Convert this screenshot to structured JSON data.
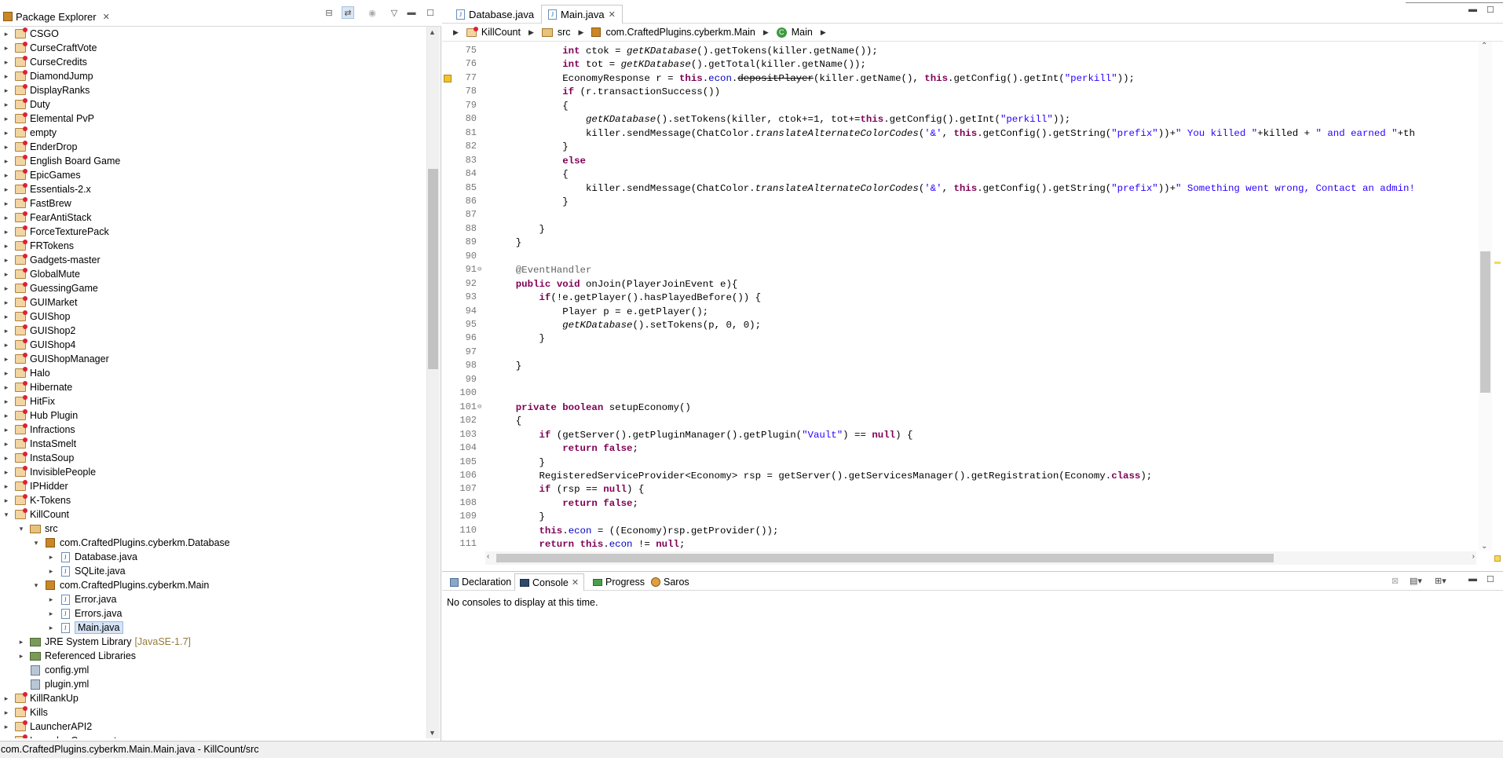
{
  "package_explorer": {
    "title": "Package Explorer",
    "items": [
      {
        "label": "CSGO",
        "type": "project",
        "depth": 0,
        "twisty": "▸"
      },
      {
        "label": "CurseCraftVote",
        "type": "project",
        "depth": 0,
        "twisty": "▸"
      },
      {
        "label": "CurseCredits",
        "type": "project",
        "depth": 0,
        "twisty": "▸"
      },
      {
        "label": "DiamondJump",
        "type": "project",
        "depth": 0,
        "twisty": "▸"
      },
      {
        "label": "DisplayRanks",
        "type": "project",
        "depth": 0,
        "twisty": "▸"
      },
      {
        "label": "Duty",
        "type": "project",
        "depth": 0,
        "twisty": "▸"
      },
      {
        "label": "Elemental PvP",
        "type": "project",
        "depth": 0,
        "twisty": "▸"
      },
      {
        "label": "empty",
        "type": "project",
        "depth": 0,
        "twisty": "▸"
      },
      {
        "label": "EnderDrop",
        "type": "project",
        "depth": 0,
        "twisty": "▸"
      },
      {
        "label": "English Board Game",
        "type": "project",
        "depth": 0,
        "twisty": "▸"
      },
      {
        "label": "EpicGames",
        "type": "project",
        "depth": 0,
        "twisty": "▸"
      },
      {
        "label": "Essentials-2.x",
        "type": "project",
        "depth": 0,
        "twisty": "▸"
      },
      {
        "label": "FastBrew",
        "type": "project",
        "depth": 0,
        "twisty": "▸"
      },
      {
        "label": "FearAntiStack",
        "type": "project",
        "depth": 0,
        "twisty": "▸"
      },
      {
        "label": "ForceTexturePack",
        "type": "project",
        "depth": 0,
        "twisty": "▸"
      },
      {
        "label": "FRTokens",
        "type": "project",
        "depth": 0,
        "twisty": "▸"
      },
      {
        "label": "Gadgets-master",
        "type": "project",
        "depth": 0,
        "twisty": "▸"
      },
      {
        "label": "GlobalMute",
        "type": "project",
        "depth": 0,
        "twisty": "▸"
      },
      {
        "label": "GuessingGame",
        "type": "project",
        "depth": 0,
        "twisty": "▸"
      },
      {
        "label": "GUIMarket",
        "type": "project",
        "depth": 0,
        "twisty": "▸"
      },
      {
        "label": "GUIShop",
        "type": "project",
        "depth": 0,
        "twisty": "▸"
      },
      {
        "label": "GUIShop2",
        "type": "project",
        "depth": 0,
        "twisty": "▸"
      },
      {
        "label": "GUIShop4",
        "type": "project",
        "depth": 0,
        "twisty": "▸"
      },
      {
        "label": "GUIShopManager",
        "type": "project",
        "depth": 0,
        "twisty": "▸"
      },
      {
        "label": "Halo",
        "type": "project",
        "depth": 0,
        "twisty": "▸"
      },
      {
        "label": "Hibernate",
        "type": "project",
        "depth": 0,
        "twisty": "▸"
      },
      {
        "label": "HitFix",
        "type": "project",
        "depth": 0,
        "twisty": "▸"
      },
      {
        "label": "Hub Plugin",
        "type": "project",
        "depth": 0,
        "twisty": "▸"
      },
      {
        "label": "Infractions",
        "type": "project",
        "depth": 0,
        "twisty": "▸"
      },
      {
        "label": "InstaSmelt",
        "type": "project",
        "depth": 0,
        "twisty": "▸"
      },
      {
        "label": "InstaSoup",
        "type": "project",
        "depth": 0,
        "twisty": "▸"
      },
      {
        "label": "InvisiblePeople",
        "type": "project",
        "depth": 0,
        "twisty": "▸"
      },
      {
        "label": "IPHidder",
        "type": "project",
        "depth": 0,
        "twisty": "▸"
      },
      {
        "label": "K-Tokens",
        "type": "project",
        "depth": 0,
        "twisty": "▸"
      },
      {
        "label": "KillCount",
        "type": "project",
        "depth": 0,
        "twisty": "▾"
      },
      {
        "label": "src",
        "type": "src",
        "depth": 1,
        "twisty": "▾"
      },
      {
        "label": "com.CraftedPlugins.cyberkm.Database",
        "type": "pkg",
        "depth": 2,
        "twisty": "▾"
      },
      {
        "label": "Database.java",
        "type": "java",
        "depth": 3,
        "twisty": "▸"
      },
      {
        "label": "SQLite.java",
        "type": "java",
        "depth": 3,
        "twisty": "▸"
      },
      {
        "label": "com.CraftedPlugins.cyberkm.Main",
        "type": "pkg",
        "depth": 2,
        "twisty": "▾"
      },
      {
        "label": "Error.java",
        "type": "java",
        "depth": 3,
        "twisty": "▸"
      },
      {
        "label": "Errors.java",
        "type": "java",
        "depth": 3,
        "twisty": "▸"
      },
      {
        "label": "Main.java",
        "type": "java",
        "depth": 3,
        "twisty": "▸",
        "selected": true
      },
      {
        "label": "JRE System Library",
        "suffix": "[JavaSE-1.7]",
        "type": "lib",
        "depth": 1,
        "twisty": "▸"
      },
      {
        "label": "Referenced Libraries",
        "type": "lib",
        "depth": 1,
        "twisty": "▸"
      },
      {
        "label": "config.yml",
        "type": "yml",
        "depth": 1,
        "twisty": ""
      },
      {
        "label": "plugin.yml",
        "type": "yml",
        "depth": 1,
        "twisty": ""
      },
      {
        "label": "KillRankUp",
        "type": "project",
        "depth": 0,
        "twisty": "▸"
      },
      {
        "label": "Kills",
        "type": "project",
        "depth": 0,
        "twisty": "▸"
      },
      {
        "label": "LauncherAPI2",
        "type": "project",
        "depth": 0,
        "twisty": "▸"
      },
      {
        "label": "LauncherCore-master",
        "type": "project",
        "depth": 0,
        "twisty": "▸"
      }
    ]
  },
  "editor": {
    "tabs": [
      {
        "label": "Database.java",
        "active": false
      },
      {
        "label": "Main.java",
        "active": true
      }
    ],
    "breadcrumb": [
      "KillCount",
      "src",
      "com.CraftedPlugins.cyberkm.Main",
      "Main"
    ],
    "lines": [
      {
        "n": "75",
        "code": "            <span class=\"kw\">int</span> ctok = <span class=\"it\">getKDatabase</span>().getTokens(killer.getName());"
      },
      {
        "n": "76",
        "code": "            <span class=\"kw\">int</span> tot = <span class=\"it\">getKDatabase</span>().getTotal(killer.getName());"
      },
      {
        "n": "77",
        "code": "            EconomyResponse r = <span class=\"kw\">this</span>.<span class=\"fld\">econ</span>.<span class=\"strike\">depositPlayer</span>(killer.getName(), <span class=\"kw\">this</span>.getConfig().getInt(<span class=\"str\">\"perkill\"</span>));",
        "warn": true
      },
      {
        "n": "78",
        "code": "            <span class=\"kw\">if</span> (r.transactionSuccess())"
      },
      {
        "n": "79",
        "code": "            {"
      },
      {
        "n": "80",
        "code": "                <span class=\"it\">getKDatabase</span>().setTokens(killer, ctok+=1, tot+=<span class=\"kw\">this</span>.getConfig().getInt(<span class=\"str\">\"perkill\"</span>));"
      },
      {
        "n": "81",
        "code": "                killer.sendMessage(ChatColor.<span class=\"it\">translateAlternateColorCodes</span>(<span class=\"str\">'&amp;'</span>, <span class=\"kw\">this</span>.getConfig().getString(<span class=\"str\">\"prefix\"</span>))+<span class=\"str\">\" You killed \"</span>+killed + <span class=\"str\">\" and earned \"</span>+th"
      },
      {
        "n": "82",
        "code": "            }"
      },
      {
        "n": "83",
        "code": "            <span class=\"kw\">else</span>"
      },
      {
        "n": "84",
        "code": "            {"
      },
      {
        "n": "85",
        "code": "                killer.sendMessage(ChatColor.<span class=\"it\">translateAlternateColorCodes</span>(<span class=\"str\">'&amp;'</span>, <span class=\"kw\">this</span>.getConfig().getString(<span class=\"str\">\"prefix\"</span>))+<span class=\"str\">\" Something went wrong, Contact an admin!</span>"
      },
      {
        "n": "86",
        "code": "            }"
      },
      {
        "n": "87",
        "code": ""
      },
      {
        "n": "88",
        "code": "        }"
      },
      {
        "n": "89",
        "code": "    }"
      },
      {
        "n": "90",
        "code": ""
      },
      {
        "n": "91",
        "code": "    <span class=\"ann\">@EventHandler</span>",
        "fold": true
      },
      {
        "n": "92",
        "code": "    <span class=\"kw\">public</span> <span class=\"kw\">void</span> onJoin(PlayerJoinEvent e){"
      },
      {
        "n": "93",
        "code": "        <span class=\"kw\">if</span>(!e.getPlayer().hasPlayedBefore()) {"
      },
      {
        "n": "94",
        "code": "            Player p = e.getPlayer();"
      },
      {
        "n": "95",
        "code": "            <span class=\"it\">getKDatabase</span>().setTokens(p, 0, 0);"
      },
      {
        "n": "96",
        "code": "        }"
      },
      {
        "n": "97",
        "code": ""
      },
      {
        "n": "98",
        "code": "    }"
      },
      {
        "n": "99",
        "code": ""
      },
      {
        "n": "100",
        "code": ""
      },
      {
        "n": "101",
        "code": "    <span class=\"kw\">private</span> <span class=\"kw\">boolean</span> setupEconomy()",
        "fold": true
      },
      {
        "n": "102",
        "code": "    {"
      },
      {
        "n": "103",
        "code": "        <span class=\"kw\">if</span> (getServer().getPluginManager().getPlugin(<span class=\"str\">\"Vault\"</span>) == <span class=\"kw\">null</span>) {"
      },
      {
        "n": "104",
        "code": "            <span class=\"kw\">return</span> <span class=\"kw\">false</span>;"
      },
      {
        "n": "105",
        "code": "        }"
      },
      {
        "n": "106",
        "code": "        RegisteredServiceProvider&lt;Economy&gt; rsp = getServer().getServicesManager().getRegistration(Economy.<span class=\"kw\">class</span>);"
      },
      {
        "n": "107",
        "code": "        <span class=\"kw\">if</span> (rsp == <span class=\"kw\">null</span>) {"
      },
      {
        "n": "108",
        "code": "            <span class=\"kw\">return</span> <span class=\"kw\">false</span>;"
      },
      {
        "n": "109",
        "code": "        }"
      },
      {
        "n": "110",
        "code": "        <span class=\"kw\">this</span>.<span class=\"fld\">econ</span> = ((Economy)rsp.getProvider());"
      },
      {
        "n": "111",
        "code": "        <span class=\"kw\">return</span> <span class=\"kw\">this</span>.<span class=\"fld\">econ</span> != <span class=\"kw\">null</span>;"
      },
      {
        "n": "112",
        "code": "    }"
      }
    ]
  },
  "bottom_panel": {
    "tabs": [
      {
        "label": "Declaration",
        "active": false,
        "icon": "declaration-icon"
      },
      {
        "label": "Console",
        "active": true,
        "icon": "console-icon"
      },
      {
        "label": "Progress",
        "active": false,
        "icon": "progress-icon"
      },
      {
        "label": "Saros",
        "active": false,
        "icon": "saros-icon"
      }
    ],
    "console_message": "No consoles to display at this time."
  },
  "status_bar": {
    "text": "com.CraftedPlugins.cyberkm.Main.Main.java - KillCount/src"
  }
}
